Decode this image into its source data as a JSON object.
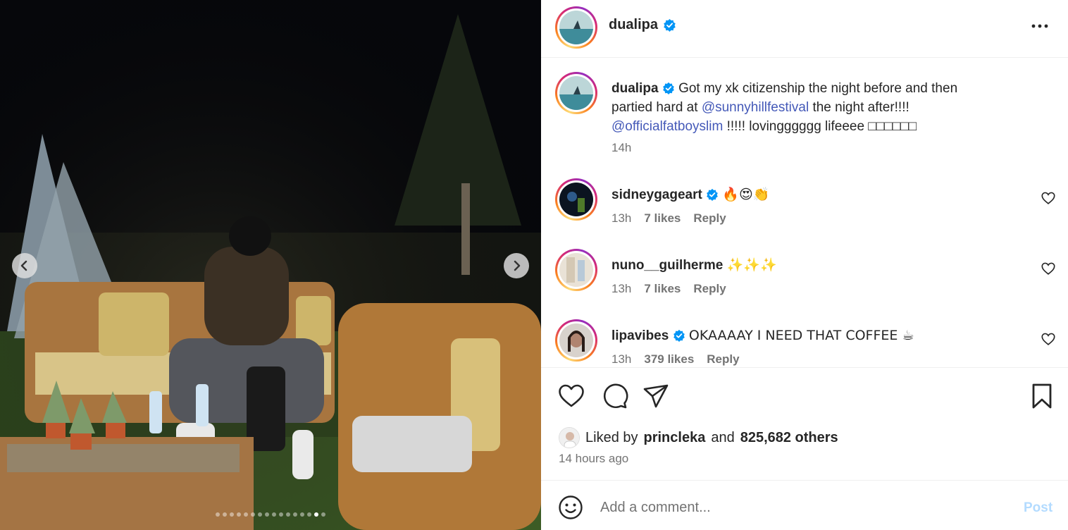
{
  "post": {
    "username": "dualipa",
    "caption": {
      "line1_text": "Got my xk citizenship the night before and then",
      "line2_pre": "partied hard at ",
      "mention1": "@sunnyhillfestival",
      "line2_post": " the night after!!!!",
      "mention2": "@officialfatboyslim",
      "line3_post": " !!!!! lovingggggg lifeeee □□□□□□"
    },
    "caption_time": "14h"
  },
  "comments": [
    {
      "username": "sidneygageart",
      "text": "🔥😍👏",
      "time": "13h",
      "likes": "7 likes",
      "reply": "Reply"
    },
    {
      "username": "nuno__guilherme",
      "text": "✨✨✨",
      "time": "13h",
      "likes": "7 likes",
      "reply": "Reply"
    },
    {
      "username": "lipavibes",
      "text": "OKAAAAY I NEED THAT COFFEE ☕",
      "time": "13h",
      "likes": "379 likes",
      "reply": "Reply"
    }
  ],
  "liked_by": {
    "prefix": "Liked by",
    "user": "princleka",
    "conj": "and",
    "others": "825,682 others"
  },
  "posted_ago": "14 hours ago",
  "comment_box": {
    "placeholder": "Add a comment...",
    "post_label": "Post"
  },
  "carousel": {
    "total": 16,
    "active_index": 14
  },
  "icons": {
    "like": "heart-icon",
    "comment": "comment-icon",
    "share": "paper-plane-icon",
    "save": "bookmark-icon",
    "emoji": "smiley-icon",
    "more": "more-options-icon",
    "prev": "chevron-left-icon",
    "next": "chevron-right-icon",
    "verified": "verified-badge-icon"
  },
  "colors": {
    "verified": "#0095f6",
    "mention": "#4459b8",
    "post_disabled": "#b3dbff",
    "secondary_text": "#737373"
  }
}
